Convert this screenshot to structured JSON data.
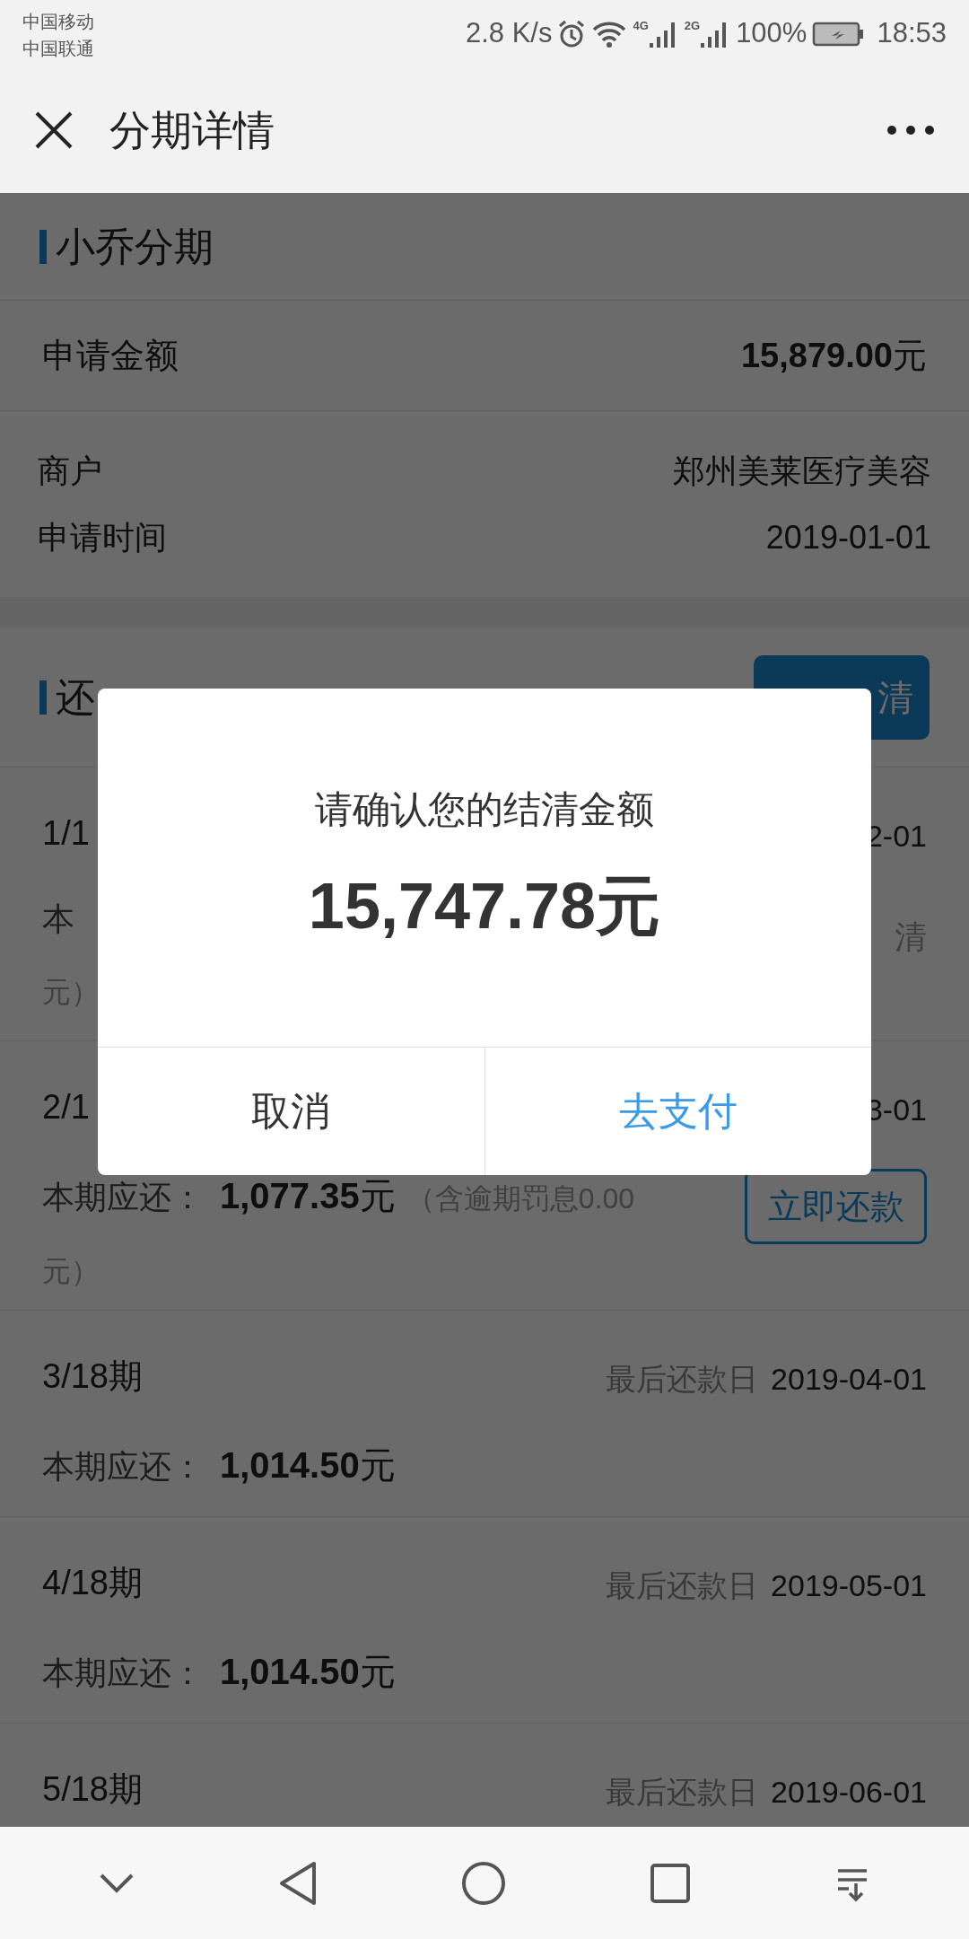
{
  "status_bar": {
    "carriers": [
      "中国移动",
      "中国联通"
    ],
    "speed": "2.8 K/s",
    "network_labels": [
      "4G",
      "2G"
    ],
    "battery": "100%",
    "time": "18:53"
  },
  "header": {
    "title": "分期详情"
  },
  "loan": {
    "title": "小乔分期",
    "amount_label": "申请金额",
    "amount": "**15,879.00**元",
    "details": [
      {
        "label": "商户",
        "value": "郑州美莱医疗美容"
      },
      {
        "label": "申请时间",
        "value": "2019-01-01"
      }
    ]
  },
  "repayment": {
    "title": "还",
    "button": "清",
    "periods": [
      {
        "kind": "partial",
        "period": "1/1",
        "date": "2-01",
        "amount_label": "本",
        "note_tail": "元）",
        "status": "清"
      },
      {
        "kind": "due",
        "period": "2/1",
        "date": "3-01",
        "amount_label": "本期应还：",
        "amount": "**1,077.35**元",
        "note": "（含逾期罚息0.00",
        "note_tail": "元）",
        "action": "立即还款"
      },
      {
        "kind": "plain",
        "period": "3/18期",
        "due_label": "最后还款日",
        "date": "2019-04-01",
        "amount_label": "本期应还：",
        "amount": "**1,014.50**元"
      },
      {
        "kind": "plain",
        "period": "4/18期",
        "due_label": "最后还款日",
        "date": "2019-05-01",
        "amount_label": "本期应还：",
        "amount": "**1,014.50**元"
      },
      {
        "kind": "plain",
        "period": "5/18期",
        "due_label": "最后还款日",
        "date": "2019-06-01"
      }
    ]
  },
  "dialog": {
    "message": "请确认您的结清金额",
    "amount": "15,747.78元",
    "buttons": [
      {
        "label": "取消",
        "kind": "cancel"
      },
      {
        "label": "去支付",
        "kind": "confirm"
      }
    ]
  }
}
